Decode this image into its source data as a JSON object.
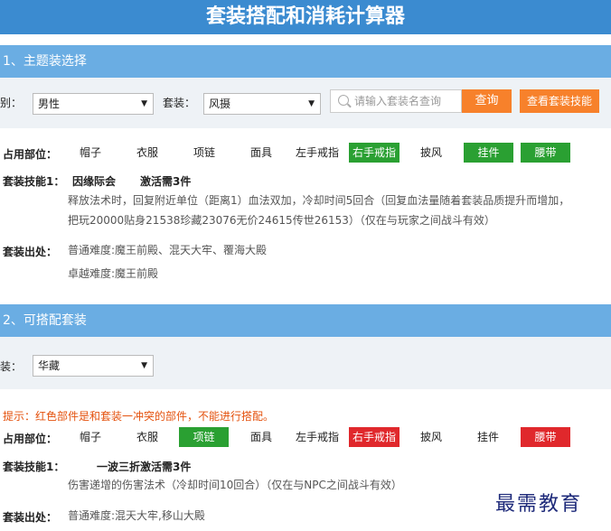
{
  "title": "套装搭配和消耗计算器",
  "section1": {
    "heading": "1、主题装选择",
    "gender_label": "性别：",
    "gender_value": "男性",
    "suit_label": "套装：",
    "suit_value": "风摄",
    "search_placeholder": "请输入套装名查询",
    "search_button": "查询",
    "skill_button": "查看套装技能",
    "slots_label": "占用部位：",
    "slots": [
      {
        "label": "帽子",
        "state": "normal"
      },
      {
        "label": "衣服",
        "state": "normal"
      },
      {
        "label": "项链",
        "state": "normal"
      },
      {
        "label": "面具",
        "state": "normal"
      },
      {
        "label": "左手戒指",
        "state": "normal"
      },
      {
        "label": "右手戒指",
        "state": "green"
      },
      {
        "label": "披风",
        "state": "normal"
      },
      {
        "label": "挂件",
        "state": "green"
      },
      {
        "label": "腰带",
        "state": "green"
      }
    ],
    "skill_label": "套装技能1：",
    "skill_name": "因缘际会",
    "skill_activate": "激活需3件",
    "skill_desc_1": "释放法术时，回复附近单位（距离1）血法双加，冷却时间5回合（回复血法量随着套装品质提升而增加，",
    "skill_desc_2": "把玩20000贴身21538珍藏23076无价24615传世26153）（仅在与玩家之间战斗有效）",
    "source_label": "套装出处：",
    "source_normal": "普通难度:魔王前殿、混天大牢、覆海大殿",
    "source_hard": "卓越难度:魔王前殿"
  },
  "section2": {
    "heading": "2、可搭配套装",
    "suit_label": "套装：",
    "suit_value": "华藏",
    "hint": "提示：红色部件是和套装一冲突的部件，不能进行搭配。",
    "slots_label": "占用部位：",
    "slots": [
      {
        "label": "帽子",
        "state": "normal"
      },
      {
        "label": "衣服",
        "state": "normal"
      },
      {
        "label": "项链",
        "state": "green"
      },
      {
        "label": "面具",
        "state": "normal"
      },
      {
        "label": "左手戒指",
        "state": "normal"
      },
      {
        "label": "右手戒指",
        "state": "red"
      },
      {
        "label": "披风",
        "state": "normal"
      },
      {
        "label": "挂件",
        "state": "normal"
      },
      {
        "label": "腰带",
        "state": "red"
      }
    ],
    "skill_label": "套装技能1：",
    "skill_name": "一波三折",
    "skill_activate": "激活需3件",
    "skill_desc": "伤害递增的伤害法术（冷却时间10回合）（仅在与NPC之间战斗有效）",
    "source_label": "套装出处：",
    "source_normal": "普通难度:混天大牢,移山大殿"
  },
  "watermark": "最需教育",
  "colors": {
    "title_bg": "#3b8bd0",
    "section_bg": "#6aade3",
    "accent_orange": "#f7812b",
    "slot_green": "#2aa032",
    "slot_red": "#e0282c",
    "hint_text": "#e4520e"
  }
}
